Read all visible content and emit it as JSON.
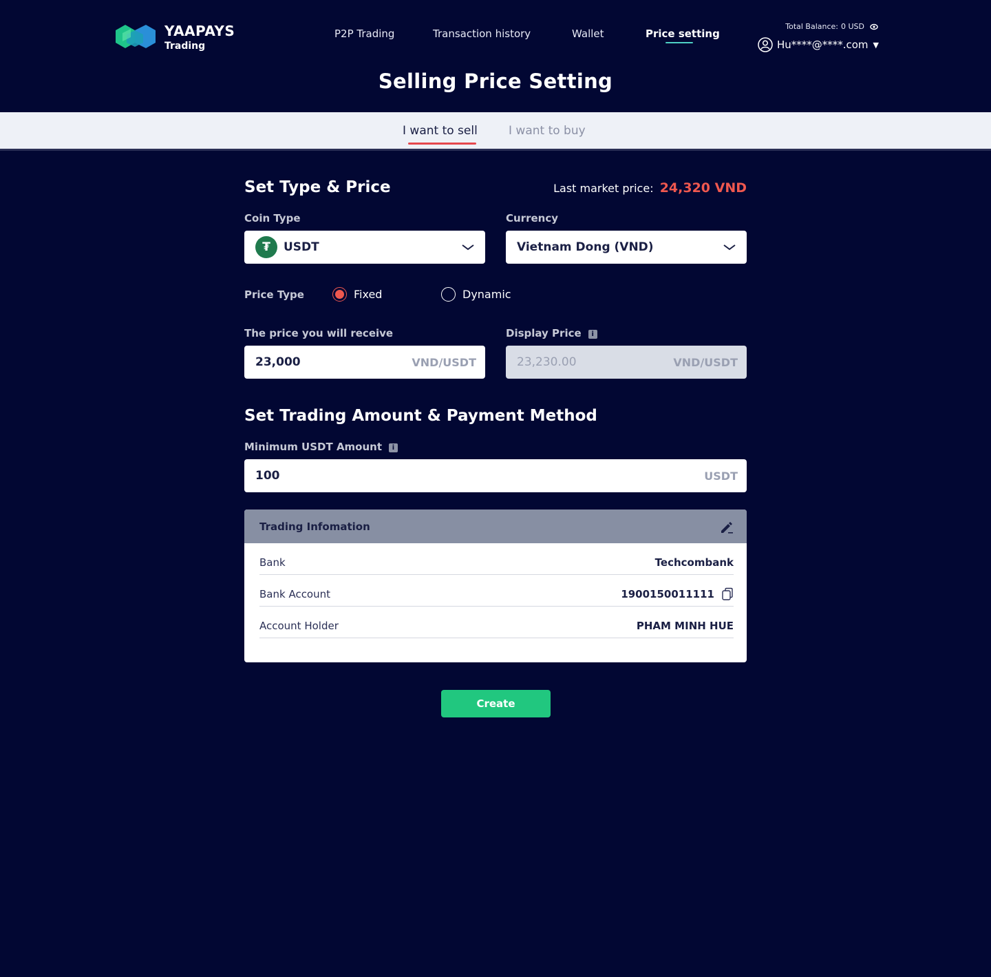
{
  "brand": {
    "name": "YAAPAYS",
    "subtitle": "Trading"
  },
  "nav": {
    "items": [
      {
        "label": "P2P Trading"
      },
      {
        "label": "Transaction history"
      },
      {
        "label": "Wallet"
      },
      {
        "label": "Price setting"
      }
    ],
    "active": "Price setting"
  },
  "account": {
    "balance_label": "Total Balance:",
    "balance_value": "0 USD",
    "email": "Hu****@****.com"
  },
  "page": {
    "title": "Selling Price Setting"
  },
  "tabs": [
    {
      "label": "I want to sell",
      "active": true
    },
    {
      "label": "I want to buy",
      "active": false
    }
  ],
  "type_price": {
    "title": "Set Type & Price",
    "market_label": "Last market price:",
    "market_value": "24,320 VND",
    "coin_label": "Coin Type",
    "coin_value": "USDT",
    "coin_icon_glyph": "₮",
    "currency_label": "Currency",
    "currency_value": "Vietnam Dong (VND)",
    "price_type_label": "Price Type",
    "price_type_options": [
      "Fixed",
      "Dynamic"
    ],
    "price_type_selected": "Fixed",
    "receive_label": "The price you will receive",
    "receive_value": "23,000",
    "receive_unit": "VND/USDT",
    "display_label": "Display Price",
    "display_value": "23,230.00",
    "display_unit": "VND/USDT"
  },
  "amount_payment": {
    "title": "Set Trading Amount & Payment Method",
    "min_label": "Minimum USDT Amount",
    "min_value": "100",
    "min_unit": "USDT"
  },
  "trading_info": {
    "title": "Trading Infomation",
    "rows": [
      {
        "key": "Bank",
        "value": "Techcombank"
      },
      {
        "key": "Bank Account",
        "value": "1900150011111"
      },
      {
        "key": "Account Holder",
        "value": "PHAM MINH HUE"
      }
    ]
  },
  "actions": {
    "create_label": "Create"
  },
  "colors": {
    "background": "#020733",
    "accent_red": "#f0584f",
    "create_green": "#21c77f",
    "nav_underline": "#4fd1c5",
    "tether_green": "#1f7a4d"
  }
}
